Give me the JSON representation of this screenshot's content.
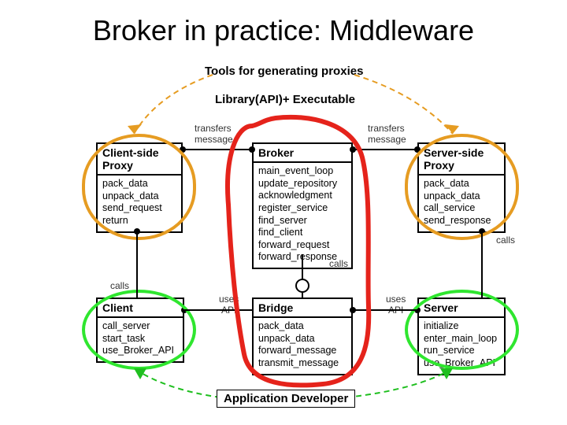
{
  "title": "Broker in practice: Middleware",
  "labels": {
    "tools": "Tools for generating proxies",
    "library": "Library(API)+ Executable",
    "app_dev": "Application Developer"
  },
  "boxes": {
    "client_proxy": {
      "title": "Client-side\nProxy",
      "ops": [
        "pack_data",
        "unpack_data",
        "send_request",
        "return"
      ]
    },
    "broker": {
      "title": "Broker",
      "ops": [
        "main_event_loop",
        "update_repository",
        "acknowledgment",
        "register_service",
        "find_server",
        "find_client",
        "forward_request",
        "forward_response"
      ]
    },
    "server_proxy": {
      "title": "Server-side\nProxy",
      "ops": [
        "pack_data",
        "unpack_data",
        "call_service",
        "send_response"
      ]
    },
    "client": {
      "title": "Client",
      "ops": [
        "call_server",
        "start_task",
        "use_Broker_API"
      ]
    },
    "bridge": {
      "title": "Bridge",
      "ops": [
        "pack_data",
        "unpack_data",
        "forward_message",
        "transmit_message"
      ]
    },
    "server": {
      "title": "Server",
      "ops": [
        "initialize",
        "enter_main_loop",
        "run_service",
        "use_Broker_API"
      ]
    }
  },
  "conn": {
    "transfers_message_l": "transfers\nmessage",
    "transfers_message_r": "transfers\nmessage",
    "calls_l": "calls",
    "calls_r": "calls",
    "calls_m": "calls",
    "uses_api_l": "uses\nAPI",
    "uses_api_r": "uses\nAPI"
  }
}
